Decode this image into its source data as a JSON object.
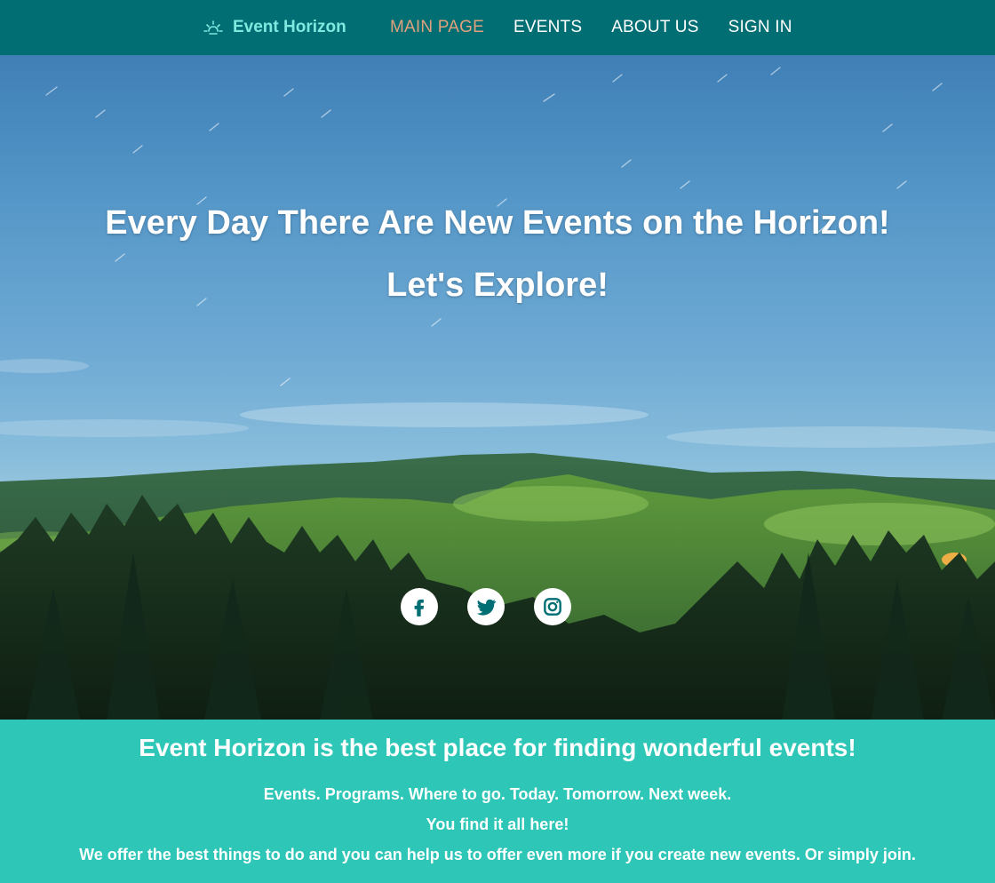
{
  "brand": {
    "name": "Event Horizon",
    "icon": "sun-horizon-icon"
  },
  "nav": {
    "items": [
      {
        "label": "MAIN PAGE",
        "active": true
      },
      {
        "label": "EVENTS",
        "active": false
      },
      {
        "label": "ABOUT US",
        "active": false
      },
      {
        "label": "SIGN IN",
        "active": false
      }
    ]
  },
  "hero": {
    "title_line1": "Every Day There Are New Events on the Horizon!",
    "title_line2": "Let's Explore!",
    "socials": [
      {
        "icon": "facebook-icon"
      },
      {
        "icon": "twitter-icon"
      },
      {
        "icon": "instagram-icon"
      }
    ]
  },
  "info": {
    "heading": "Event Horizon is the best place for finding wonderful events!",
    "line1": "Events. Programs. Where to go. Today. Tomorrow. Next week.",
    "line2": "You find it all here!",
    "line3": "We offer the best things to do and you can help us to offer even more if you create new events. Or simply join."
  },
  "colors": {
    "navbar": "#006e73",
    "brand_text": "#7fe9e0",
    "nav_active": "#e0a17c",
    "info_bg": "#2ec6b6"
  }
}
